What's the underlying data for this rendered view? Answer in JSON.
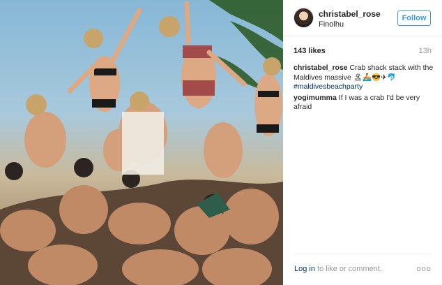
{
  "post": {
    "username": "christabel_rose",
    "location": "Finolhu",
    "follow_label": "Follow",
    "likes": "143 likes",
    "time_ago": "13h",
    "comments": [
      {
        "user": "christabel_rose",
        "text": " Crab shack stack with the Maldives massive 🏝🚣😎✈🐬",
        "tag": "#maldivesbeachparty"
      },
      {
        "user": "yogimumma",
        "text": " If I was a crab I'd be very afraid",
        "tag": ""
      }
    ],
    "login_link": "Log in",
    "login_rest": " to like or comment.",
    "more": "ooo"
  },
  "icons": {
    "more": "more-options-icon",
    "avatar": "avatar"
  }
}
